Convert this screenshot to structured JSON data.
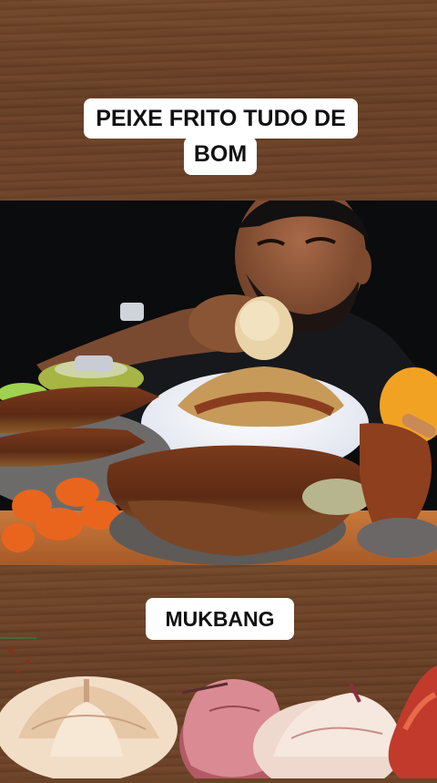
{
  "captions": {
    "top_line_1": "PEIXE FRITO TUDO DE",
    "top_line_2": "BOM",
    "bottom": "MUKBANG"
  },
  "colors": {
    "wood": "#6b4327",
    "caption_bg": "#ffffff",
    "caption_text": "#111111",
    "video_bg": "#0b0c0e"
  }
}
